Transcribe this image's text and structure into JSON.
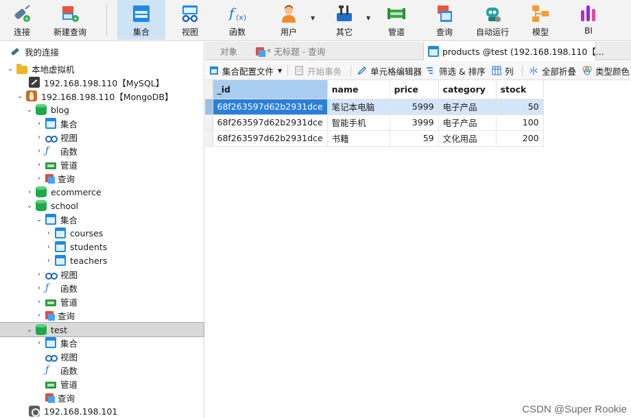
{
  "toolbar": {
    "items": [
      {
        "label": "连接"
      },
      {
        "label": "新建查询"
      },
      {
        "label": "集合"
      },
      {
        "label": "视图"
      },
      {
        "label": "函数"
      },
      {
        "label": "用户"
      },
      {
        "label": "其它"
      },
      {
        "label": "管道"
      },
      {
        "label": "查询"
      },
      {
        "label": "自动运行"
      },
      {
        "label": "模型"
      },
      {
        "label": "BI"
      }
    ],
    "active": "集合"
  },
  "tree": {
    "root": "我的连接",
    "folder": "本地虚拟机",
    "conn_mysql": "192.168.198.110【MySQL】",
    "conn_mongo": "192.168.198.110【MongoDB】",
    "db_blog": "blog",
    "blog_items": [
      "集合",
      "视图",
      "函数",
      "管道",
      "查询"
    ],
    "db_ecommerce": "ecommerce",
    "db_school": "school",
    "school_collections_label": "集合",
    "school_collections": [
      "courses",
      "students",
      "teachers"
    ],
    "school_items": [
      "视图",
      "函数",
      "管道",
      "查询"
    ],
    "db_test": "test",
    "test_items": [
      "集合",
      "视图",
      "函数",
      "管道",
      "查询"
    ],
    "conn_other": "192.168.198.101"
  },
  "tabs": {
    "objects": "对象",
    "untitled_query": "* 无标题 - 查询",
    "products": "products @test (192.168.198.110【..."
  },
  "objbar": {
    "profile": "集合配置文件",
    "begin_tx": "开始事务",
    "cell_editor": "单元格编辑器",
    "filter_sort": "筛选 & 排序",
    "columns": "列",
    "collapse_all": "全部折叠",
    "type_color": "类型颜色"
  },
  "grid": {
    "columns": [
      "_id",
      "name",
      "price",
      "category",
      "stock"
    ],
    "rows": [
      [
        "68f263597d62b2931dce",
        "笔记本电脑",
        "5999",
        "电子产品",
        "50"
      ],
      [
        "68f263597d62b2931dce",
        "智能手机",
        "3999",
        "电子产品",
        "100"
      ],
      [
        "68f263597d62b2931dce",
        "书籍",
        "59",
        "文化用品",
        "200"
      ]
    ]
  },
  "watermark": "CSDN @Super Rookie",
  "colors": {
    "accent": "#1e88e5",
    "selection": "#2b7fd9",
    "row_highlight": "#d3e5f8"
  }
}
